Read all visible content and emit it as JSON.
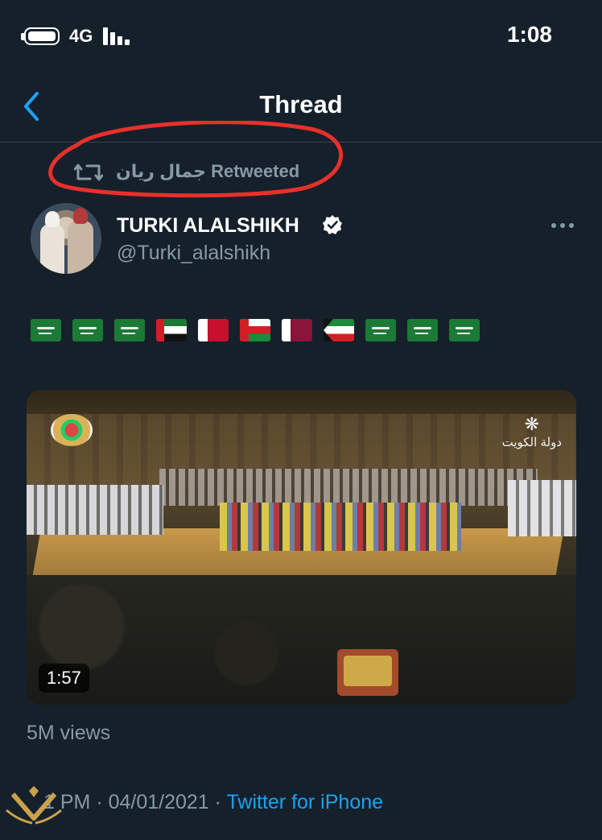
{
  "status_bar": {
    "network": "4G",
    "time": "1:08"
  },
  "nav": {
    "title": "Thread",
    "back_icon": "chevron-left-icon"
  },
  "retweet": {
    "icon": "retweet-icon",
    "label": "جمال ريان Retweeted",
    "annotation_color": "#e8302a"
  },
  "tweet": {
    "author_name": "TURKI ALALSHIKH",
    "verified": true,
    "handle": "@Turki_alalshikh",
    "more_icon": "more-horizontal-icon",
    "flags": [
      "saudi-arabia-flag",
      "saudi-arabia-flag",
      "saudi-arabia-flag",
      "uae-flag",
      "bahrain-flag",
      "oman-flag",
      "qatar-flag",
      "kuwait-flag",
      "saudi-arabia-flag",
      "saudi-arabia-flag",
      "saudi-arabia-flag"
    ],
    "video": {
      "duration": "1:57",
      "tv_logo_text": "دولة الكويت"
    },
    "views": "5M views",
    "time_partial": "1 PM",
    "date": "04/01/2021",
    "source": "Twitter for iPhone"
  },
  "colors": {
    "background": "#15202b",
    "secondary_text": "#8899a6",
    "accent": "#1da1f2"
  }
}
